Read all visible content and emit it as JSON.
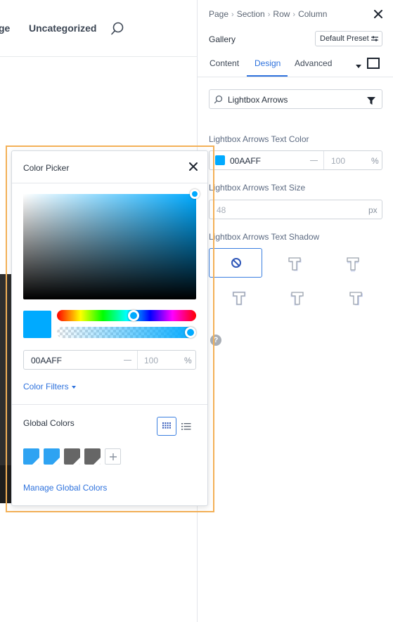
{
  "page": {
    "nav": {
      "partial_link": "ge",
      "uncategorized_link": "Uncategorized",
      "search_icon": "search-icon"
    }
  },
  "panel": {
    "breadcrumb": [
      "Page",
      "Section",
      "Row",
      "Column"
    ],
    "module_title": "Gallery",
    "preset_label": "Default Preset",
    "tabs": {
      "content": "Content",
      "design": "Design",
      "advanced": "Advanced",
      "active": "Design"
    },
    "filter": {
      "value": "Lightbox Arrows"
    },
    "text_color": {
      "label": "Lightbox Arrows Text Color",
      "hex": "00AAFF",
      "opacity": "100",
      "unit": "%",
      "swatch_color": "#00AAFF"
    },
    "text_size": {
      "label": "Lightbox Arrows Text Size",
      "placeholder": "48",
      "unit": "px"
    },
    "text_shadow": {
      "label": "Lightbox Arrows Text Shadow",
      "selected": "none",
      "options": [
        "none",
        "shadow-1",
        "shadow-2",
        "shadow-3",
        "shadow-4",
        "shadow-5"
      ]
    },
    "help_glyph": "?"
  },
  "color_picker": {
    "title": "Color Picker",
    "hex": "00AAFF",
    "opacity": "100",
    "unit": "%",
    "current_color": "#00AAFF",
    "color_filters_label": "Color Filters",
    "global_colors_title": "Global Colors",
    "global_swatches": [
      "#2EA3F2",
      "#2EA3F2",
      "#666666",
      "#666666"
    ],
    "manage_label": "Manage Global Colors"
  },
  "colors": {
    "accent": "#2E72DD",
    "highlight_border": "#F3B057"
  }
}
